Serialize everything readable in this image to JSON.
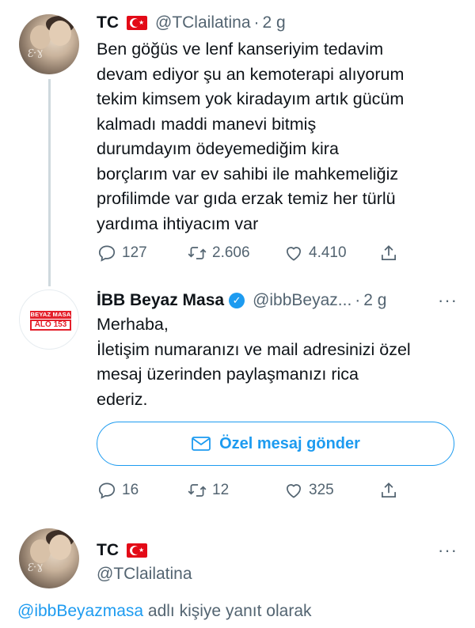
{
  "tweets": [
    {
      "name": "TC",
      "handle": "@TClailatina",
      "separator": "·",
      "time": "2 g",
      "text_lines": [
        "Ben göğüs ve lenf kanseriyim tedavim",
        "devam ediyor şu an kemoterapi alıyorum",
        "tekim kimsem yok kiradayım artık gücüm",
        "kalmadı maddi manevi bitmiş",
        "durumdayım ödeyemediğim kira",
        "borçlarım var ev sahibi ile mahkemeliğiz",
        "profilimde var gıda erzak temiz her türlü",
        "yardıma ihtiyacım var"
      ],
      "replies": "127",
      "retweets": "2.606",
      "likes": "4.410"
    },
    {
      "name": "İBB Beyaz Masa",
      "handle": "@ibbBeyaz...",
      "separator": "·",
      "time": "2 g",
      "avatar_logo_top": "BEYAZ MASA",
      "avatar_logo_bottom": "ALO 153",
      "text_lines": [
        "Merhaba,",
        "İletişim numaranızı ve mail adresinizi özel",
        "mesaj üzerinden paylaşmanızı rica",
        "ederiz."
      ],
      "dm_button_label": "Özel mesaj gönder",
      "replies": "16",
      "retweets": "12",
      "likes": "325"
    },
    {
      "name": "TC",
      "handle": "@TClailatina",
      "reply_mention": "@ibbBeyazmasa",
      "reply_suffix": "adlı kişiye yanıt olarak"
    }
  ],
  "more_icon_text": "···",
  "verified_mark": "✓",
  "colors": {
    "accent": "#1d9bf0",
    "text": "#0f1419",
    "muted": "#536471",
    "thread_line": "#cfd9de",
    "brand_red": "#e4202b"
  },
  "icons": [
    "reply-icon",
    "retweet-icon",
    "like-icon",
    "share-icon",
    "mail-icon",
    "verified-badge-icon",
    "turkey-flag-icon",
    "more-icon"
  ]
}
